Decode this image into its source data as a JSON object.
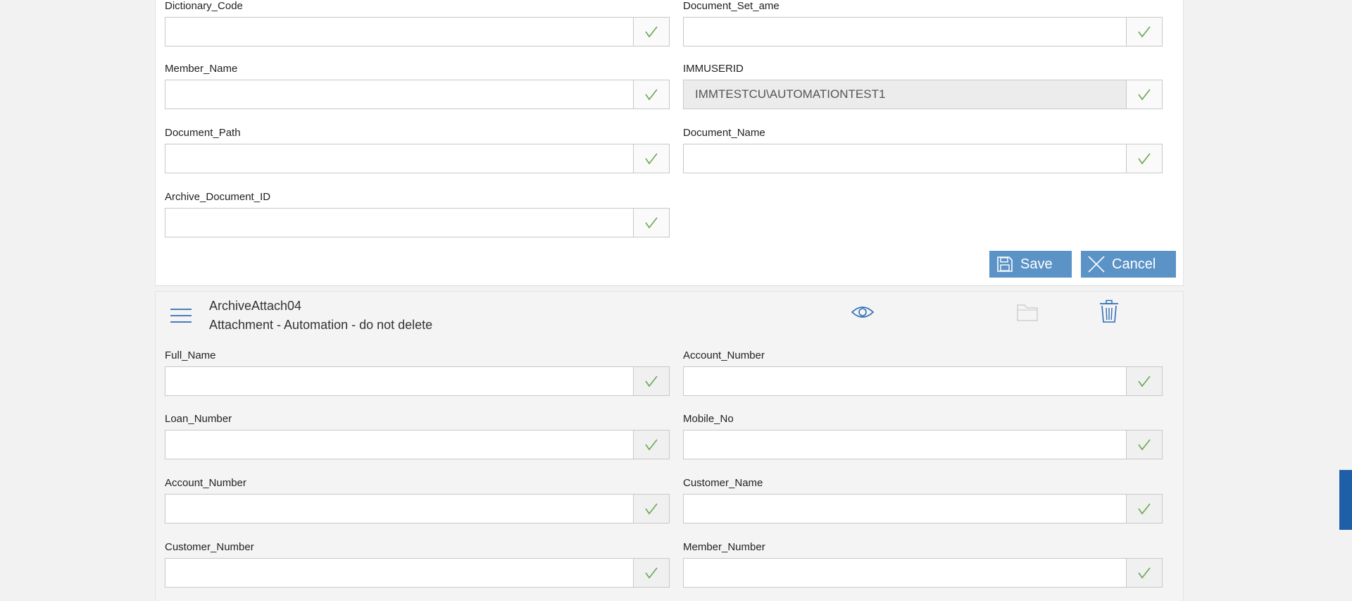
{
  "top_form": {
    "fields": [
      {
        "label": "Dictionary_Code",
        "value": "",
        "readonly": false
      },
      {
        "label": "Document_Set_ame",
        "value": "",
        "readonly": false
      },
      {
        "label": "Member_Name",
        "value": "",
        "readonly": false
      },
      {
        "label": "IMMUSERID",
        "value": "IMMTESTCU\\AUTOMATIONTEST1",
        "readonly": true
      },
      {
        "label": "Document_Path",
        "value": "",
        "readonly": false
      },
      {
        "label": "Document_Name",
        "value": "",
        "readonly": false
      },
      {
        "label": "Archive_Document_ID",
        "value": "",
        "readonly": false
      }
    ],
    "save_label": "Save",
    "cancel_label": "Cancel"
  },
  "attachment": {
    "title": "ArchiveAttach04",
    "subtitle": "Attachment - Automation - do not delete",
    "icons": {
      "menu": "hamburger-menu-icon",
      "view": "eye-icon",
      "folder": "folder-icon",
      "delete": "trash-icon"
    },
    "fields": [
      {
        "label": "Full_Name",
        "value": ""
      },
      {
        "label": "Account_Number",
        "value": ""
      },
      {
        "label": "Loan_Number",
        "value": ""
      },
      {
        "label": "Mobile_No",
        "value": ""
      },
      {
        "label": "Account_Number",
        "value": ""
      },
      {
        "label": "Customer_Name",
        "value": ""
      },
      {
        "label": "Customer_Number",
        "value": ""
      },
      {
        "label": "Member_Number",
        "value": ""
      }
    ]
  },
  "colors": {
    "accent": "#5b93c7",
    "check": "#6aa84f",
    "icon_blue": "#2f6eb5",
    "side_tab": "#1f5fa8"
  }
}
